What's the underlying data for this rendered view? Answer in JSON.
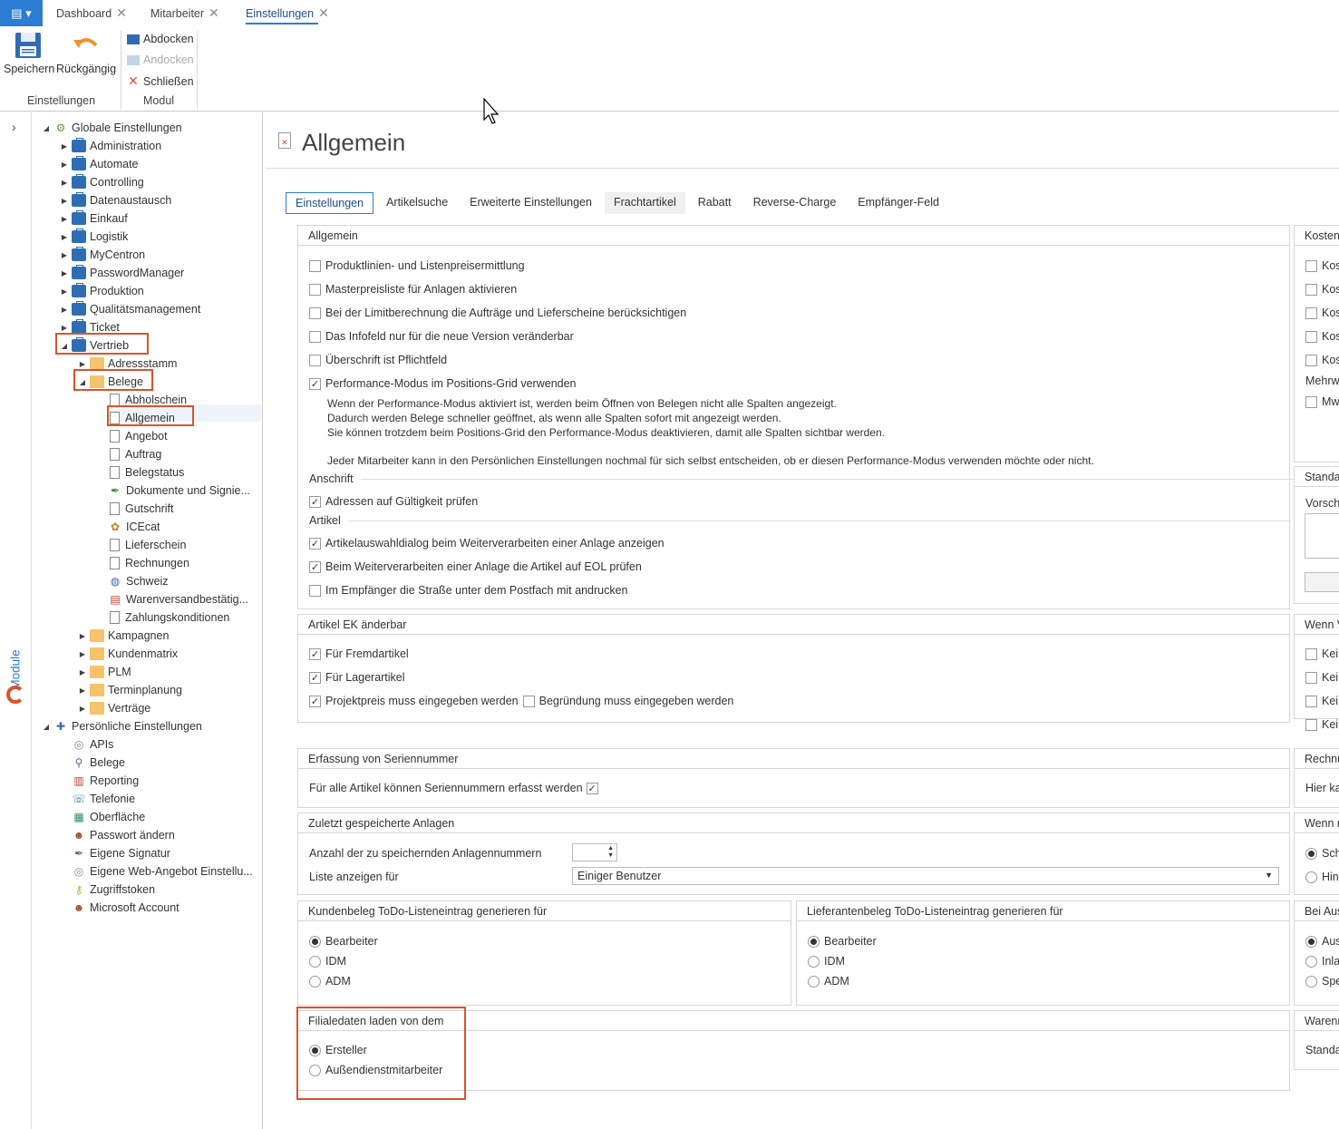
{
  "tabs": {
    "dashboard": "Dashboard",
    "mitarbeiter": "Mitarbeiter",
    "einstellungen": "Einstellungen"
  },
  "ribbon": {
    "save": "Speichern",
    "undo": "Rückgängig",
    "abdocken": "Abdocken",
    "andocken": "Andocken",
    "schliessen": "Schließen",
    "group_settings": "Einstellungen",
    "group_module": "Modul"
  },
  "sidebar_label": "Module",
  "tree": {
    "globale": "Globale Einstellungen",
    "administration": "Administration",
    "automate": "Automate",
    "controlling": "Controlling",
    "datenaustausch": "Datenaustausch",
    "einkauf": "Einkauf",
    "logistik": "Logistik",
    "mycentron": "MyCentron",
    "passwordmanager": "PasswordManager",
    "produktion": "Produktion",
    "qualitaet": "Qualitätsmanagement",
    "ticket": "Ticket",
    "vertrieb": "Vertrieb",
    "adressstamm": "Adressstamm",
    "belege": "Belege",
    "abholschein": "Abholschein",
    "allgemein": "Allgemein",
    "angebot": "Angebot",
    "auftrag": "Auftrag",
    "belegstatus": "Belegstatus",
    "dokumente": "Dokumente und Signie...",
    "gutschrift": "Gutschrift",
    "icecat": "ICEcat",
    "lieferschein": "Lieferschein",
    "rechnungen": "Rechnungen",
    "schweiz": "Schweiz",
    "warenversand": "Warenversandbestätig...",
    "zahlung": "Zahlungskonditionen",
    "kampagnen": "Kampagnen",
    "kundenmatrix": "Kundenmatrix",
    "plm": "PLM",
    "terminplanung": "Terminplanung",
    "vertraege": "Verträge",
    "persoenlich": "Persönliche Einstellungen",
    "apis": "APIs",
    "p_belege": "Belege",
    "reporting": "Reporting",
    "telefonie": "Telefonie",
    "oberflaeche": "Oberfläche",
    "passwort": "Passwort ändern",
    "signatur": "Eigene Signatur",
    "webangebot": "Eigene Web-Angebot Einstellu...",
    "zugriff": "Zugriffstoken",
    "microsoft": "Microsoft Account"
  },
  "page": {
    "title": "Allgemein"
  },
  "ptabs": [
    "Einstellungen",
    "Artikelsuche",
    "Erweiterte Einstellungen",
    "Frachtartikel",
    "Rabatt",
    "Reverse-Charge",
    "Empfänger-Feld"
  ],
  "allgemein": {
    "header": "Allgemein",
    "c1": "Produktlinien- und Listenpreisermittlung",
    "c2": "Masterpreisliste für Anlagen aktivieren",
    "c3": "Bei der Limitberechnung die Aufträge und Lieferscheine berücksichtigen",
    "c4": "Das Infofeld nur für die neue Version veränderbar",
    "c5": "Überschrift ist Pflichtfeld",
    "c6": "Performance-Modus im Positions-Grid verwenden",
    "n1": "Wenn der Performance-Modus aktiviert ist, werden beim Öffnen von Belegen nicht alle Spalten angezeigt.",
    "n2": "Dadurch werden Belege schneller geöffnet, als wenn alle Spalten sofort mit angezeigt werden.",
    "n3": "Sie können trotzdem beim Positions-Grid den Performance-Modus deaktivieren, damit alle Spalten sichtbar werden.",
    "n4": "Jeder Mitarbeiter kann in den Persönlichen Einstellungen nochmal für sich selbst entscheiden, ob er diesen Performance-Modus verwenden möchte oder nicht.",
    "anschrift": "Anschrift",
    "c7": "Adressen auf Gültigkeit prüfen",
    "artikel": "Artikel",
    "c8": "Artikelauswahldialog beim Weiterverarbeiten einer Anlage anzeigen",
    "c9": "Beim Weiterverarbeiten einer Anlage die Artikel auf EOL prüfen",
    "c10": "Im Empfänger die Straße unter dem Postfach mit andrucken"
  },
  "ek": {
    "header": "Artikel EK änderbar",
    "c1": "Für Fremdartikel",
    "c2": "Für Lagerartikel",
    "c3": "Projektpreis muss eingegeben werden",
    "c4": "Begründung muss eingegeben werden"
  },
  "serien": {
    "header": "Erfassung von Seriennummer",
    "c1": "Für alle Artikel können Seriennummern erfasst werden"
  },
  "zuletzt": {
    "header": "Zuletzt gespeicherte Anlagen",
    "l1": "Anzahl der zu speichernden Anlagennummern",
    "l2": "Liste anzeigen für",
    "combo": "Einiger Benutzer"
  },
  "kunden": {
    "header": "Kundenbeleg ToDo-Listeneintrag generieren für",
    "o1": "Bearbeiter",
    "o2": "IDM",
    "o3": "ADM"
  },
  "liefer": {
    "header": "Lieferantenbeleg ToDo-Listeneintrag generieren für",
    "o1": "Bearbeiter",
    "o2": "IDM",
    "o3": "ADM"
  },
  "filial": {
    "header": "Filialedaten laden von dem",
    "o1": "Ersteller",
    "o2": "Außendienstmitarbeiter"
  },
  "right": {
    "kosten": "Kosten",
    "k1": "Kost",
    "k2": "Kost",
    "k3": "Kost",
    "k4": "Kost",
    "k5": "Kost",
    "mehr": "Mehrw",
    "mw": "Mw",
    "standard": "Standa",
    "vorscha": "Vorscha",
    "wenn1": "Wenn V",
    "kein1": "Kein",
    "kein2": "Kein",
    "kein3": "Kein",
    "kein4": "Kein",
    "rechnu": "Rechnu",
    "hierka": "Hier ka",
    "wenn2": "Wenn r",
    "scha": "Scha",
    "hinv": "Hinv",
    "beiaus": "Bei Aus",
    "aus": "Aus",
    "inla": "Inla",
    "spe": "Spe",
    "warenr": "Warenr",
    "standar": "Standar"
  }
}
